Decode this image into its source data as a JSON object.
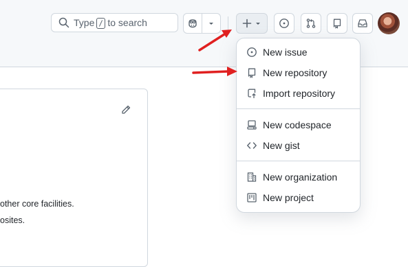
{
  "header": {
    "search": {
      "pre": "Type",
      "post": "to search",
      "icon": "search-icon"
    },
    "buttons": {
      "copilot": "copilot-icon",
      "create": "plus-icon",
      "issues": "issue-opened-icon",
      "pull_requests": "git-pull-request-icon",
      "repositories": "repo-icon",
      "inbox": "inbox-icon"
    }
  },
  "card": {
    "lines": [
      "other core facilities.",
      "osites."
    ]
  },
  "create_menu": {
    "items": [
      {
        "label": "New issue",
        "icon": "issue-opened-icon"
      },
      {
        "label": "New repository",
        "icon": "repo-icon"
      },
      {
        "label": "Import repository",
        "icon": "repo-push-icon"
      },
      {
        "label": "New codespace",
        "icon": "codespaces-icon"
      },
      {
        "label": "New gist",
        "icon": "code-icon"
      },
      {
        "label": "New organization",
        "icon": "organization-icon"
      },
      {
        "label": "New project",
        "icon": "project-icon"
      }
    ]
  },
  "annotations": {
    "arrow_color": "#e02020"
  }
}
